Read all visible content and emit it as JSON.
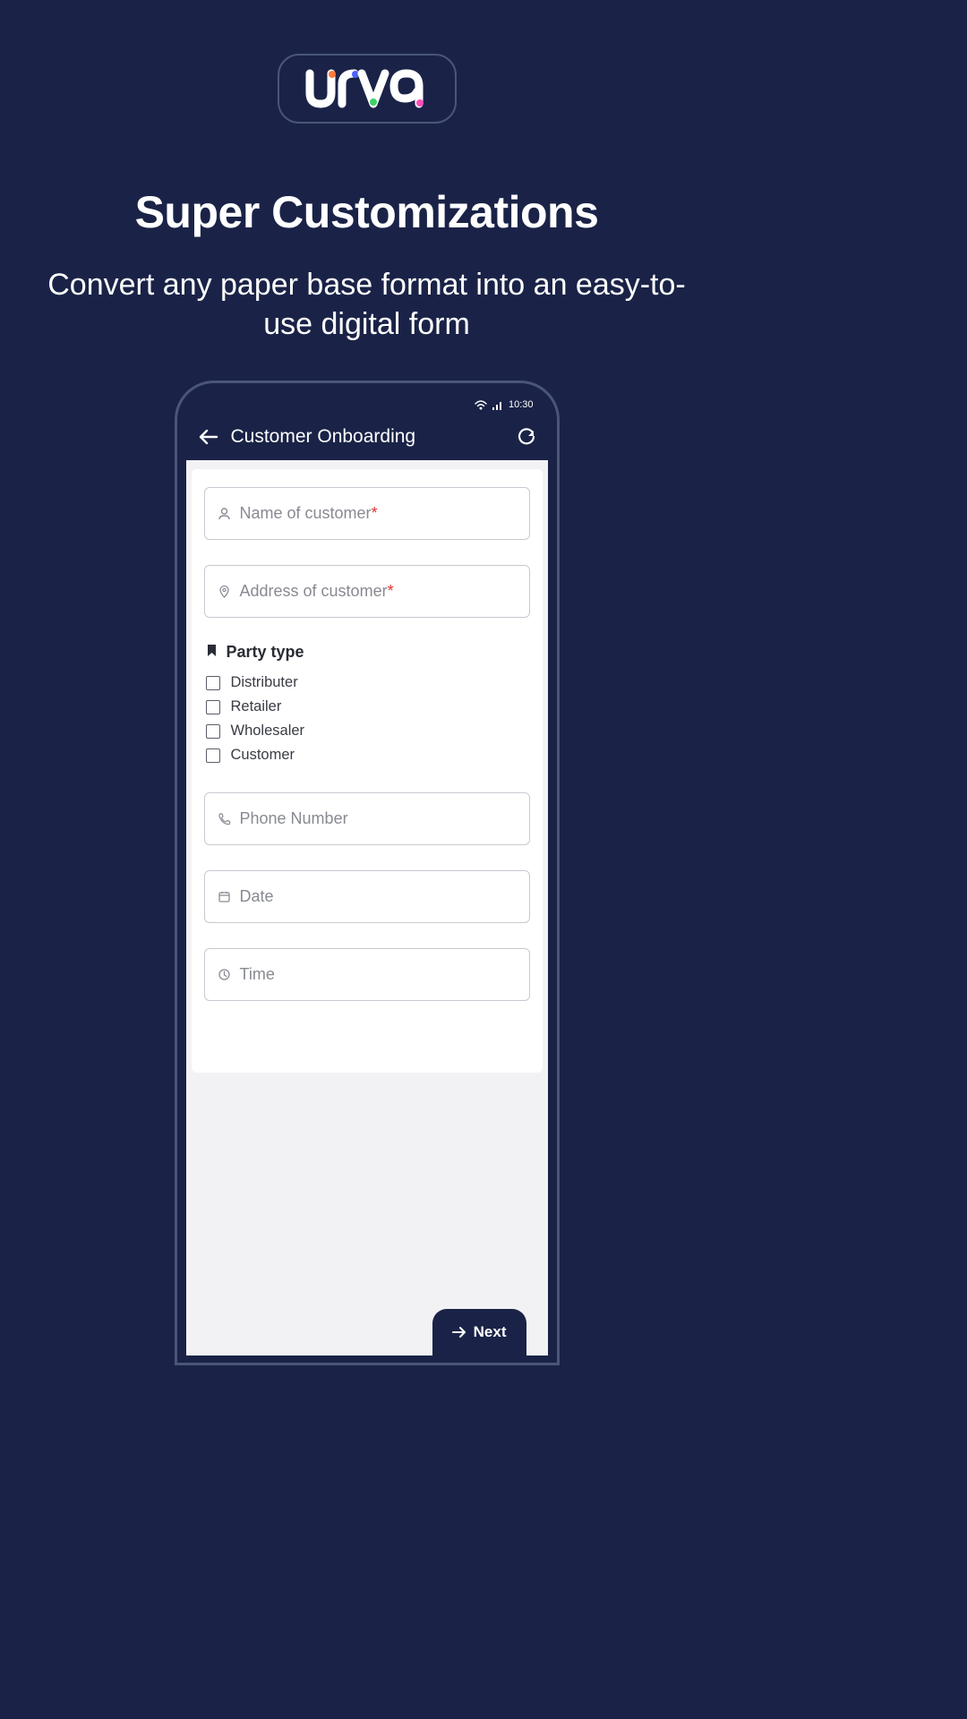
{
  "brand": {
    "name": "urva"
  },
  "hero": {
    "headline": "Super Customizations",
    "subheadline": "Convert any paper base format into an easy-to-use digital form"
  },
  "statusbar": {
    "time": "10:30"
  },
  "screen": {
    "title": "Customer Onboarding",
    "fields": {
      "name": {
        "placeholder": "Name of customer",
        "required": true
      },
      "address": {
        "placeholder": "Address of customer",
        "required": true
      },
      "phone": {
        "placeholder": "Phone Number",
        "required": false
      },
      "date": {
        "placeholder": "Date",
        "required": false
      },
      "time": {
        "placeholder": "Time",
        "required": false
      }
    },
    "partyType": {
      "label": "Party type",
      "options": [
        "Distributer",
        "Retailer",
        "Wholesaler",
        "Customer"
      ]
    },
    "nextButton": "Next"
  }
}
